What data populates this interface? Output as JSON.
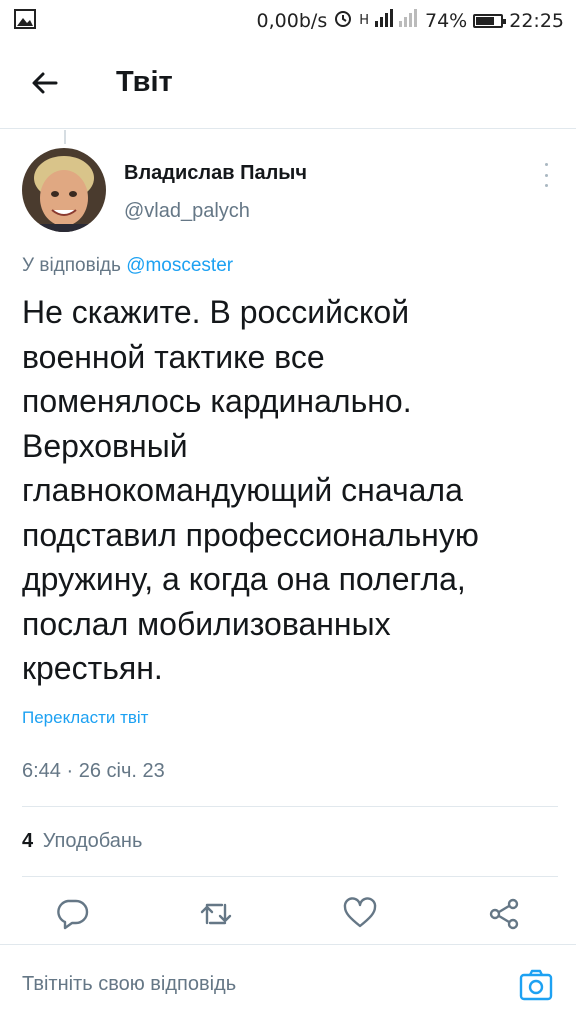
{
  "status_bar": {
    "speed": "0,00b/s",
    "network": "H",
    "battery": "74%",
    "battery_level": 0.74,
    "time": "22:25"
  },
  "header": {
    "title": "Твіт"
  },
  "tweet": {
    "author_name": "Владислав Палыч",
    "author_handle": "@vlad_palych",
    "reply_prefix": "У відповідь",
    "reply_mention": "@moscester",
    "text_lines": [
      "Не скажите. В российской",
      "военной тактике все",
      "поменялось кардинально.",
      "Верховный",
      "главнокомандующий сначала",
      "подставил профессиональную",
      "дружину, а когда она полегла,",
      "послал мобилизованных",
      "крестьян."
    ],
    "translate_label": "Перекласти твіт",
    "timestamp": "6:44 · 26 січ. 23",
    "likes_count": "4",
    "likes_label": "Уподобань"
  },
  "actions": {
    "icons": [
      "reply-icon",
      "retweet-icon",
      "like-icon",
      "share-icon"
    ]
  },
  "composer": {
    "placeholder": "Твітніть свою відповідь"
  },
  "colors": {
    "accent": "#1da1f2",
    "text": "#14171a",
    "muted": "#657786",
    "divider": "#e1e8ed"
  }
}
